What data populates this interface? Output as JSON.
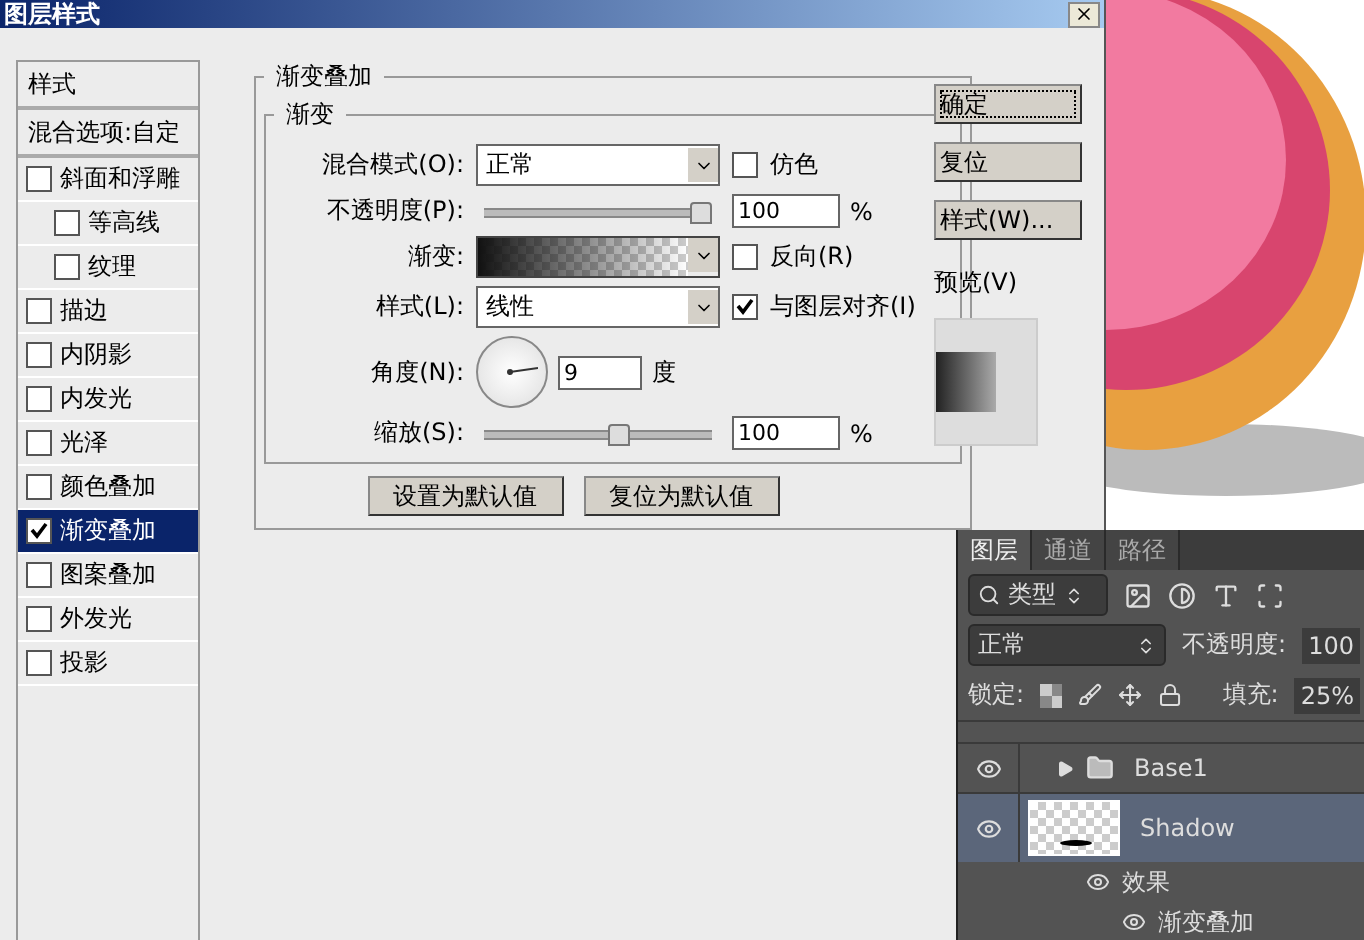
{
  "dialog": {
    "title": "图层样式"
  },
  "styles_list": {
    "header": "样式",
    "blend_options": "混合选项:自定",
    "items": [
      {
        "label": "斜面和浮雕",
        "checked": false,
        "selected": false,
        "children": [
          {
            "label": "等高线",
            "checked": false,
            "selected": false
          },
          {
            "label": "纹理",
            "checked": false,
            "selected": false
          }
        ]
      },
      {
        "label": "描边",
        "checked": false,
        "selected": false
      },
      {
        "label": "内阴影",
        "checked": false,
        "selected": false
      },
      {
        "label": "内发光",
        "checked": false,
        "selected": false
      },
      {
        "label": "光泽",
        "checked": false,
        "selected": false
      },
      {
        "label": "颜色叠加",
        "checked": false,
        "selected": false
      },
      {
        "label": "渐变叠加",
        "checked": true,
        "selected": true
      },
      {
        "label": "图案叠加",
        "checked": false,
        "selected": false
      },
      {
        "label": "外发光",
        "checked": false,
        "selected": false
      },
      {
        "label": "投影",
        "checked": false,
        "selected": false
      }
    ]
  },
  "panel": {
    "title": "渐变叠加",
    "group": {
      "title": "渐变",
      "blend_mode": {
        "label": "混合模式(O):",
        "value": "正常"
      },
      "dither": {
        "label": "仿色",
        "checked": false
      },
      "opacity": {
        "label": "不透明度(P):",
        "level": 1,
        "value": "100",
        "unit": "%"
      },
      "gradient": {
        "label": "渐变:"
      },
      "reverse": {
        "label": "反向(R)",
        "checked": false
      },
      "style": {
        "label": "样式(L):",
        "value": "线性"
      },
      "align": {
        "label": "与图层对齐(I)",
        "checked": true
      },
      "angle": {
        "label": "角度(N):",
        "value": "9",
        "unit": "度"
      },
      "scale": {
        "label": "缩放(S):",
        "level": 0.6,
        "value": "100",
        "unit": "%"
      }
    },
    "buttons": [
      "设置为默认值",
      "复位为默认值"
    ]
  },
  "actions": {
    "buttons": [
      {
        "label": "确定",
        "focused": true
      },
      {
        "label": "复位",
        "focused": false
      },
      {
        "label": "样式(W)...",
        "focused": false
      }
    ],
    "preview": "预览(V)"
  },
  "layers_panel": {
    "tabs": [
      {
        "label": "图层",
        "selected": true
      },
      {
        "label": "通道",
        "selected": false
      },
      {
        "label": "路径",
        "selected": false
      }
    ],
    "filter": "类型",
    "blend_mode": "正常",
    "opacity": {
      "label": "不透明度:",
      "value": "100"
    },
    "lock": "锁定:",
    "fill": {
      "label": "填充:",
      "value": "25%"
    },
    "layers": [
      {
        "name": "Base1",
        "kind": "group",
        "selected": false,
        "visible": true
      },
      {
        "name": "Shadow",
        "kind": "layer",
        "selected": true,
        "visible": true,
        "effects": {
          "label": "效果",
          "items": [
            "渐变叠加"
          ]
        }
      }
    ]
  }
}
